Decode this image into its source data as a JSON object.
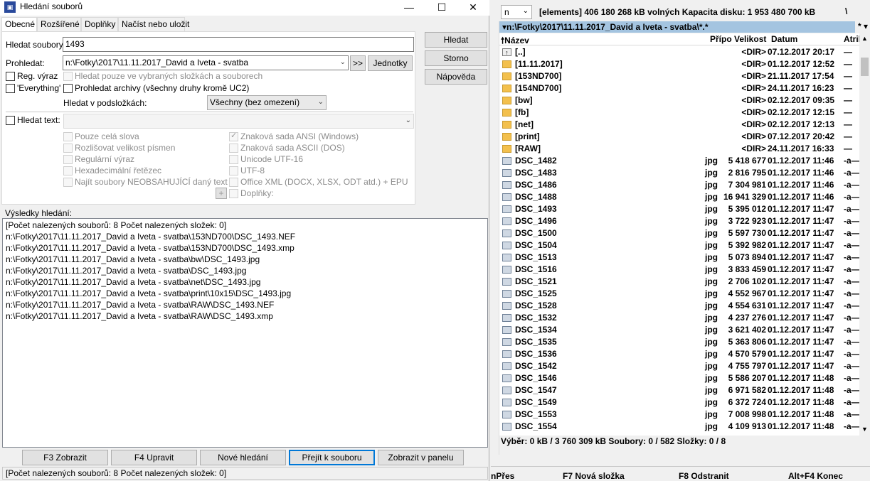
{
  "dialog": {
    "title": "Hledání souborů",
    "tabs": [
      "Obecné",
      "Rozšířené",
      "Doplňky",
      "Načíst nebo uložit"
    ],
    "search_files_label": "Hledat soubory:",
    "search_files_value": "1493",
    "search_in_label": "Prohledat:",
    "search_in_value": "n:\\Fotky\\2017\\11.11.2017_David a Iveta - svatba",
    "arrows_button": ">>",
    "drives_button": "Jednotky",
    "reg_expr_label": "Reg. výraz",
    "everything_label": "'Everything'",
    "selected_only_label": "Hledat pouze ve vybraných složkách a souborech",
    "archives_label": "Prohledat archivy (všechny druhy kromě UC2)",
    "subdirs_label": "Hledat v podsložkách:",
    "subdirs_value": "Všechny (bez omezení)",
    "find_text_label": "Hledat text:",
    "text_options_left": [
      "Pouze celá slova",
      "Rozlišovat velikost písmen",
      "Regulární výraz",
      "Hexadecimální řetězec",
      "Najít soubory NEOBSAHUJÍCÍ daný text"
    ],
    "text_options_right": [
      "Znaková sada ANSI (Windows)",
      "Znaková sada ASCII (DOS)",
      "Unicode UTF-16",
      "UTF-8",
      "Office XML (DOCX, XLSX, ODT atd.) + EPU",
      "Doplňky:"
    ],
    "plus_button": "+",
    "side_buttons": [
      "Hledat",
      "Storno",
      "Nápověda"
    ],
    "results_label": "Výsledky hledání:",
    "results": [
      "[Počet nalezených souborů: 8   Počet nalezených složek: 0]",
      "n:\\Fotky\\2017\\11.11.2017_David a Iveta - svatba\\153ND700\\DSC_1493.NEF",
      "n:\\Fotky\\2017\\11.11.2017_David a Iveta - svatba\\153ND700\\DSC_1493.xmp",
      "n:\\Fotky\\2017\\11.11.2017_David a Iveta - svatba\\bw\\DSC_1493.jpg",
      "n:\\Fotky\\2017\\11.11.2017_David a Iveta - svatba\\DSC_1493.jpg",
      "n:\\Fotky\\2017\\11.11.2017_David a Iveta - svatba\\net\\DSC_1493.jpg",
      "n:\\Fotky\\2017\\11.11.2017_David a Iveta - svatba\\print\\10x15\\DSC_1493.jpg",
      "n:\\Fotky\\2017\\11.11.2017_David a Iveta - svatba\\RAW\\DSC_1493.NEF",
      "n:\\Fotky\\2017\\11.11.2017_David a Iveta - svatba\\RAW\\DSC_1493.xmp"
    ],
    "bottom_buttons": [
      "F3 Zobrazit",
      "F4 Upravit",
      "Nové hledání",
      "Přejít k souboru",
      "Zobrazit v panelu"
    ],
    "status": "[Počet nalezených souborů: 8   Počet nalezených složek: 0]"
  },
  "tc": {
    "drive": "n",
    "disk_info": "[elements]  406 180 268 kB volných   Kapacita disku: 1 953 480 700 kB",
    "backslash": "\\",
    "path": "▾n:\\Fotky\\2017\\11.11.2017_David a Iveta - svatba\\*.*",
    "path_filter": "*  ▾",
    "columns": [
      "🠕Název",
      "Přípo",
      "Velikost",
      "Datum",
      "Atribut"
    ],
    "rows": [
      {
        "icon": "up-icon",
        "name": "[..]",
        "ext": "",
        "size": "<DIR>",
        "date": "07.12.2017 20:17",
        "attr": "—"
      },
      {
        "icon": "folder-icon",
        "name": "[11.11.2017]",
        "ext": "",
        "size": "<DIR>",
        "date": "01.12.2017 12:52",
        "attr": "—"
      },
      {
        "icon": "folder-icon",
        "name": "[153ND700]",
        "ext": "",
        "size": "<DIR>",
        "date": "21.11.2017 17:54",
        "attr": "—"
      },
      {
        "icon": "folder-icon",
        "name": "[154ND700]",
        "ext": "",
        "size": "<DIR>",
        "date": "24.11.2017 16:23",
        "attr": "—"
      },
      {
        "icon": "folder-icon",
        "name": "[bw]",
        "ext": "",
        "size": "<DIR>",
        "date": "02.12.2017 09:35",
        "attr": "—"
      },
      {
        "icon": "folder-icon",
        "name": "[fb]",
        "ext": "",
        "size": "<DIR>",
        "date": "02.12.2017 12:15",
        "attr": "—"
      },
      {
        "icon": "folder-icon",
        "name": "[net]",
        "ext": "",
        "size": "<DIR>",
        "date": "02.12.2017 12:13",
        "attr": "—"
      },
      {
        "icon": "folder-icon",
        "name": "[print]",
        "ext": "",
        "size": "<DIR>",
        "date": "07.12.2017 20:42",
        "attr": "—"
      },
      {
        "icon": "folder-icon",
        "name": "[RAW]",
        "ext": "",
        "size": "<DIR>",
        "date": "24.11.2017 16:33",
        "attr": "—"
      },
      {
        "icon": "file-icon",
        "name": "DSC_1482",
        "ext": "jpg",
        "size": "5 418 677",
        "date": "01.12.2017 11:46",
        "attr": "-a—"
      },
      {
        "icon": "file-icon",
        "name": "DSC_1483",
        "ext": "jpg",
        "size": "2 816 795",
        "date": "01.12.2017 11:46",
        "attr": "-a—"
      },
      {
        "icon": "file-icon",
        "name": "DSC_1486",
        "ext": "jpg",
        "size": "7 304 981",
        "date": "01.12.2017 11:46",
        "attr": "-a—"
      },
      {
        "icon": "file-icon",
        "name": "DSC_1488",
        "ext": "jpg",
        "size": "16 941 329",
        "date": "01.12.2017 11:46",
        "attr": "-a—"
      },
      {
        "icon": "file-icon",
        "name": "DSC_1493",
        "ext": "jpg",
        "size": "5 395 012",
        "date": "01.12.2017 11:47",
        "attr": "-a—"
      },
      {
        "icon": "file-icon",
        "name": "DSC_1496",
        "ext": "jpg",
        "size": "3 722 923",
        "date": "01.12.2017 11:47",
        "attr": "-a—"
      },
      {
        "icon": "file-icon",
        "name": "DSC_1500",
        "ext": "jpg",
        "size": "5 597 730",
        "date": "01.12.2017 11:47",
        "attr": "-a—"
      },
      {
        "icon": "file-icon",
        "name": "DSC_1504",
        "ext": "jpg",
        "size": "5 392 982",
        "date": "01.12.2017 11:47",
        "attr": "-a—"
      },
      {
        "icon": "file-icon",
        "name": "DSC_1513",
        "ext": "jpg",
        "size": "5 073 894",
        "date": "01.12.2017 11:47",
        "attr": "-a—"
      },
      {
        "icon": "file-icon",
        "name": "DSC_1516",
        "ext": "jpg",
        "size": "3 833 459",
        "date": "01.12.2017 11:47",
        "attr": "-a—"
      },
      {
        "icon": "file-icon",
        "name": "DSC_1521",
        "ext": "jpg",
        "size": "2 706 102",
        "date": "01.12.2017 11:47",
        "attr": "-a—"
      },
      {
        "icon": "file-icon",
        "name": "DSC_1525",
        "ext": "jpg",
        "size": "4 552 967",
        "date": "01.12.2017 11:47",
        "attr": "-a—"
      },
      {
        "icon": "file-icon",
        "name": "DSC_1528",
        "ext": "jpg",
        "size": "4 554 631",
        "date": "01.12.2017 11:47",
        "attr": "-a—"
      },
      {
        "icon": "file-icon",
        "name": "DSC_1532",
        "ext": "jpg",
        "size": "4 237 276",
        "date": "01.12.2017 11:47",
        "attr": "-a—"
      },
      {
        "icon": "file-icon",
        "name": "DSC_1534",
        "ext": "jpg",
        "size": "3 621 402",
        "date": "01.12.2017 11:47",
        "attr": "-a—"
      },
      {
        "icon": "file-icon",
        "name": "DSC_1535",
        "ext": "jpg",
        "size": "5 363 806",
        "date": "01.12.2017 11:47",
        "attr": "-a—"
      },
      {
        "icon": "file-icon",
        "name": "DSC_1536",
        "ext": "jpg",
        "size": "4 570 579",
        "date": "01.12.2017 11:47",
        "attr": "-a—"
      },
      {
        "icon": "file-icon",
        "name": "DSC_1542",
        "ext": "jpg",
        "size": "4 755 797",
        "date": "01.12.2017 11:47",
        "attr": "-a—"
      },
      {
        "icon": "file-icon",
        "name": "DSC_1546",
        "ext": "jpg",
        "size": "5 586 207",
        "date": "01.12.2017 11:48",
        "attr": "-a—"
      },
      {
        "icon": "file-icon",
        "name": "DSC_1547",
        "ext": "jpg",
        "size": "6 971 582",
        "date": "01.12.2017 11:48",
        "attr": "-a—"
      },
      {
        "icon": "file-icon",
        "name": "DSC_1549",
        "ext": "jpg",
        "size": "6 372 724",
        "date": "01.12.2017 11:48",
        "attr": "-a—"
      },
      {
        "icon": "file-icon",
        "name": "DSC_1553",
        "ext": "jpg",
        "size": "7 008 998",
        "date": "01.12.2017 11:48",
        "attr": "-a—"
      },
      {
        "icon": "file-icon",
        "name": "DSC_1554",
        "ext": "jpg",
        "size": "4 109 913",
        "date": "01.12.2017 11:48",
        "attr": "-a—"
      }
    ],
    "status": "Výběr: 0 kB / 3 760 309 kB   Soubory: 0 / 582   Složky: 0 / 8",
    "fkeys": [
      "nPřes",
      "F7 Nová složka",
      "F8 Odstranit",
      "Alt+F4 Konec"
    ]
  }
}
